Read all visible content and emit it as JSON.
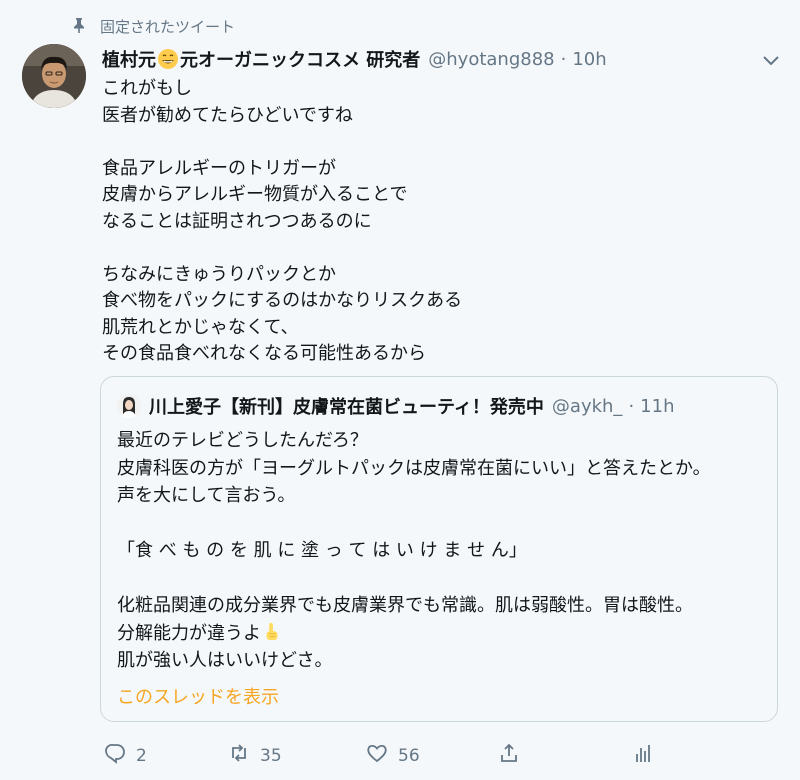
{
  "pinned": {
    "label": "固定されたツイート",
    "icon": "pin-icon"
  },
  "tweet": {
    "author": {
      "name_part1": "植村元",
      "name_emoji": "grinning-face",
      "name_part2": "元オーガニックコスメ 研究者",
      "handle": "@hyotang888",
      "separator": "·",
      "time": "10h"
    },
    "text": "これがもし\n医者が勧めてたらひどいですね\n\n食品アレルギーのトリガーが\n皮膚からアレルギー物質が入ることで\nなることは証明されつつあるのに\n\nちなみにきゅうりパックとか\n食べ物をパックにするのはかなりリスクある\n肌荒れとかじゃなくて、\nその食品食べれなくなる可能性あるから"
  },
  "quote": {
    "author": {
      "name": "川上愛子【新刊】皮膚常在菌ビューティ！発売中",
      "handle": "@aykh_",
      "separator": "·",
      "time": "11h"
    },
    "text_before_emoji": "最近のテレビどうしたんだろ？\n皮膚科医の方が「ヨーグルトパックは皮膚常在菌にいい」と答えたとか。\n声を大にして言おう。\n\n「食 べ も の を 肌 に 塗 っ て は い け ま せ ん」\n\n化粧品関連の成分業界でも皮膚業界でも常識。肌は弱酸性。胃は酸性。\n分解能力が違うよ",
    "emoji": "pointing-up-hand",
    "text_after_emoji": "\n肌が強い人はいいけどさ。",
    "show_thread": "このスレッドを表示"
  },
  "actions": {
    "reply": {
      "icon": "reply-icon",
      "count": "2"
    },
    "retweet": {
      "icon": "retweet-icon",
      "count": "35"
    },
    "like": {
      "icon": "heart-icon",
      "count": "56"
    },
    "share": {
      "icon": "share-icon",
      "count": ""
    },
    "analytics": {
      "icon": "analytics-icon",
      "count": ""
    }
  },
  "colors": {
    "background": "#f5f8fa",
    "text": "#14171a",
    "secondary": "#657786",
    "border": "#ccd6dd",
    "link": "#f5a623"
  }
}
